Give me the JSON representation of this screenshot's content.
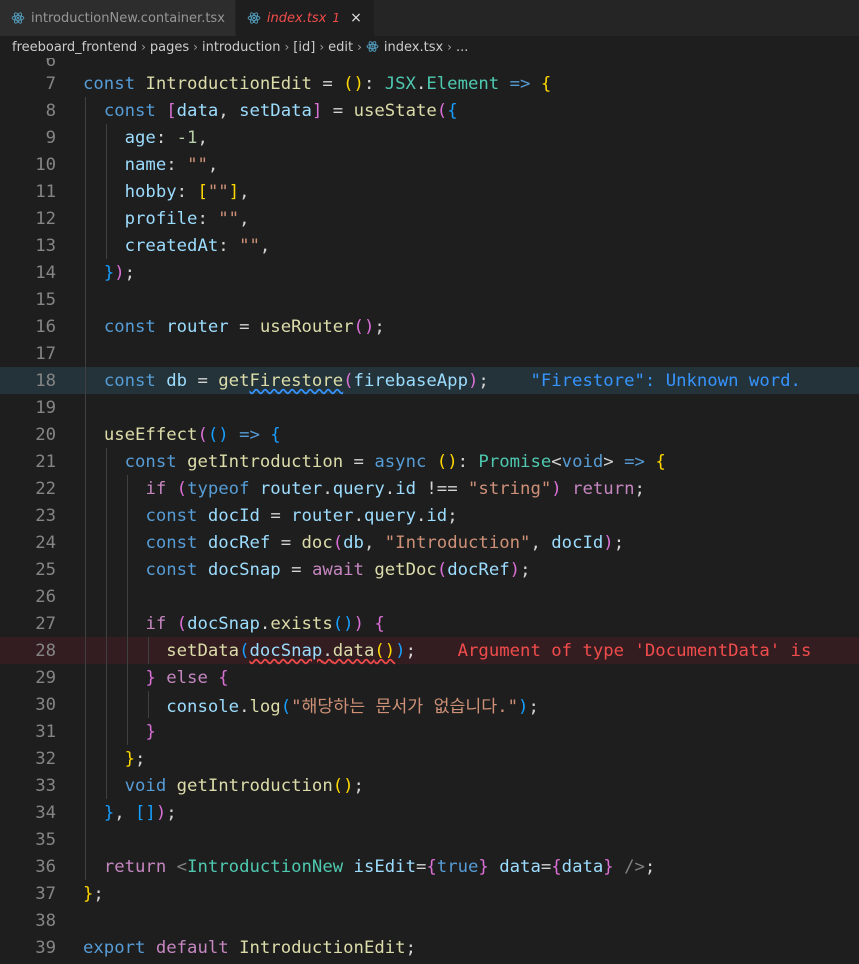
{
  "tabs": [
    {
      "label": "introductionNew.container.tsx",
      "icon": "react-icon",
      "active": false
    },
    {
      "label": "index.tsx",
      "badge": "1",
      "icon": "react-icon",
      "active": true,
      "close": "×"
    }
  ],
  "breadcrumb": [
    "freeboard_frontend",
    "pages",
    "introduction",
    "[id]",
    "edit",
    "index.tsx",
    "..."
  ],
  "editor": {
    "partial_top_line": "6",
    "line_numbers": [
      "7",
      "8",
      "9",
      "10",
      "11",
      "12",
      "13",
      "14",
      "15",
      "16",
      "17",
      "18",
      "19",
      "20",
      "21",
      "22",
      "23",
      "24",
      "25",
      "26",
      "27",
      "28",
      "29",
      "30",
      "31",
      "32",
      "33",
      "34",
      "35",
      "36",
      "37",
      "38",
      "39"
    ],
    "diagnostics": {
      "line18": "\"Firestore\": Unknown word.",
      "line28": "Argument of type 'DocumentData' is"
    },
    "strings": {
      "empty": "\"\"",
      "string": "\"string\"",
      "introduction": "\"Introduction\"",
      "korean_msg": "\"해당하는 문서가 없습니다.\""
    },
    "numbers": {
      "minus_one": "-1"
    },
    "keywords_misc": {
      "true": "true"
    }
  },
  "colors": {
    "background": "#1e1e1e",
    "info": "#3794ff",
    "error": "#f14c4c"
  }
}
